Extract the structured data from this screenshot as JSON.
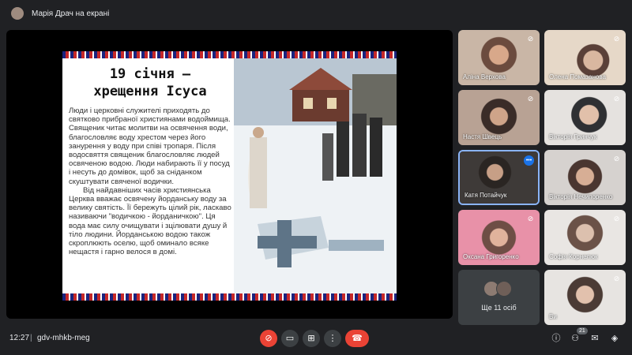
{
  "presenter": {
    "label": "Марія Драч на екрані"
  },
  "slide": {
    "title_line1": "19 січня —",
    "title_line2": "хрещення Ісуса",
    "paragraph1": "Люди і церковні служителі приходять до святково прибраної християнами водоймища. Священик читає молитви на освячення води, благословляє воду хрестом через його занурення у воду при співі тропаря. Після водосвяття священик благословляє людей освяченою водою. Люди набирають її у посуд і несуть до домівок, щоб за сніданком скуштувати свяченої водички.",
    "paragraph2": "Від найдавніших часів християнська Церква вважає освячену йорданську воду за велику святість. Її бережуть цілий рік, ласкаво називаючи \"водичкою - йорданичкою\". Ця вода має силу очищувати і зцілювати душу й тіло людини. Йорданською водою також скроплюють оселю, щоб оминало всяке нещастя і гарно велося в домі."
  },
  "participants": [
    {
      "name": "Аліна Верхова",
      "muted": true,
      "speaking": false
    },
    {
      "name": "Олена Помазанова",
      "muted": true,
      "speaking": false
    },
    {
      "name": "Настя Швець",
      "muted": true,
      "speaking": false
    },
    {
      "name": "Вікторія Гринчук",
      "muted": true,
      "speaking": false
    },
    {
      "name": "Катя Потайчук",
      "muted": false,
      "speaking": true
    },
    {
      "name": "Вікторія Нечипоренко",
      "muted": true,
      "speaking": false
    },
    {
      "name": "Оксана Григоренко",
      "muted": true,
      "speaking": false
    },
    {
      "name": "Софія Корнелюк",
      "muted": true,
      "speaking": false
    },
    {
      "name": "Ще 11 осіб"
    },
    {
      "name": "Ви",
      "muted": true,
      "speaking": false
    }
  ],
  "bottombar": {
    "time": "12:27",
    "separator": "|",
    "meeting_code": "gdv-mhkb-meg",
    "participants_count": "21"
  },
  "icons": {
    "mic_muted": "mic-off-icon",
    "camera": "camera-icon",
    "present": "present-screen-icon",
    "more": "more-vert-icon",
    "hangup": "hangup-icon",
    "info": "info-icon",
    "people": "people-icon",
    "chat": "chat-icon",
    "activities": "activities-icon"
  },
  "colors": {
    "background": "#202124",
    "tile": "#3c4043",
    "active_border": "#8ab4f8",
    "danger": "#ea4335",
    "speaking": "#1a73e8"
  }
}
